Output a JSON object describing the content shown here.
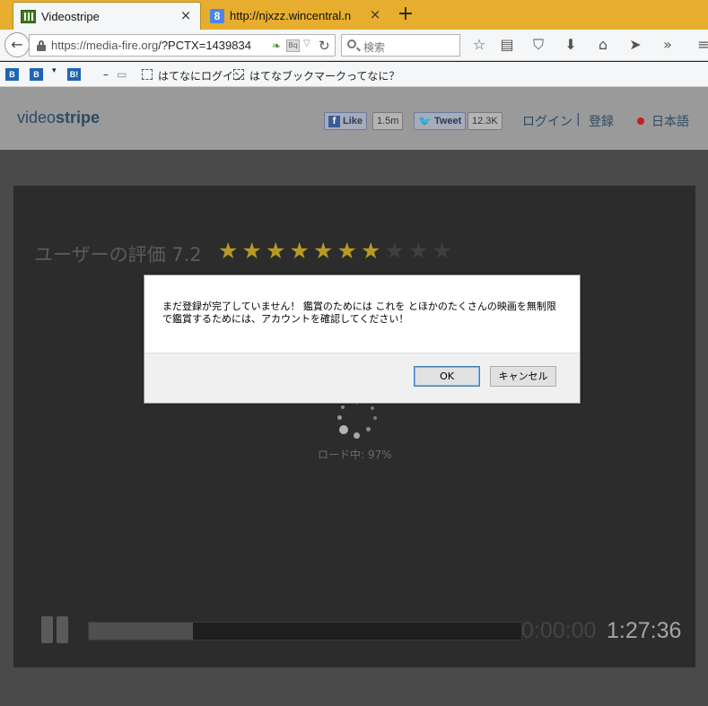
{
  "tabs": [
    {
      "title": "Videostripe",
      "close": "×"
    },
    {
      "title": "http://njxzz.wincentral.n",
      "close": "×",
      "icon_letter": "8"
    }
  ],
  "new_tab": "+",
  "nav": {
    "back": "←",
    "url_host": "https://media-fire.org",
    "url_path": "/?PCTX=1439834",
    "search_placeholder": "検索"
  },
  "toolbar_icons": [
    "star-icon",
    "reading-list-icon",
    "pocket-icon",
    "download-icon",
    "home-icon",
    "send-icon",
    "overflow-icon",
    "menu-icon"
  ],
  "bookmarks": {
    "hatena_login": "はてなにログイン",
    "hatena_about": "はてなブックマークってなに？",
    "dash": "–"
  },
  "site": {
    "logo_light": "video",
    "logo_bold": "stripe",
    "fb_like": "Like",
    "fb_count": "1.5m",
    "tweet": "Tweet",
    "tweet_count": "12.3K",
    "login": "ログイン",
    "separator": "|",
    "register": "登録",
    "language": "日本語"
  },
  "player": {
    "rating_label": "ユーザーの評価 7.2",
    "rating_stars": 7,
    "rating_max": 10,
    "loading": "ロード中: 97%",
    "progress": 0.24,
    "time_current": "0:00:00",
    "time_total": "1:27:36"
  },
  "dialog": {
    "message": "まだ登録が完了していません！ 鑑賞のためには これを とほかのたくさんの映画を無制限で鑑賞するためには、アカウントを確認してください！",
    "ok": "OK",
    "cancel": "キャンセル"
  },
  "colors": {
    "tabstrip": "#e6ad2e",
    "header": "#9a9a9a",
    "star_on": "#b89a22",
    "star_off": "#3f3f3f",
    "link": "#2d4a66"
  }
}
